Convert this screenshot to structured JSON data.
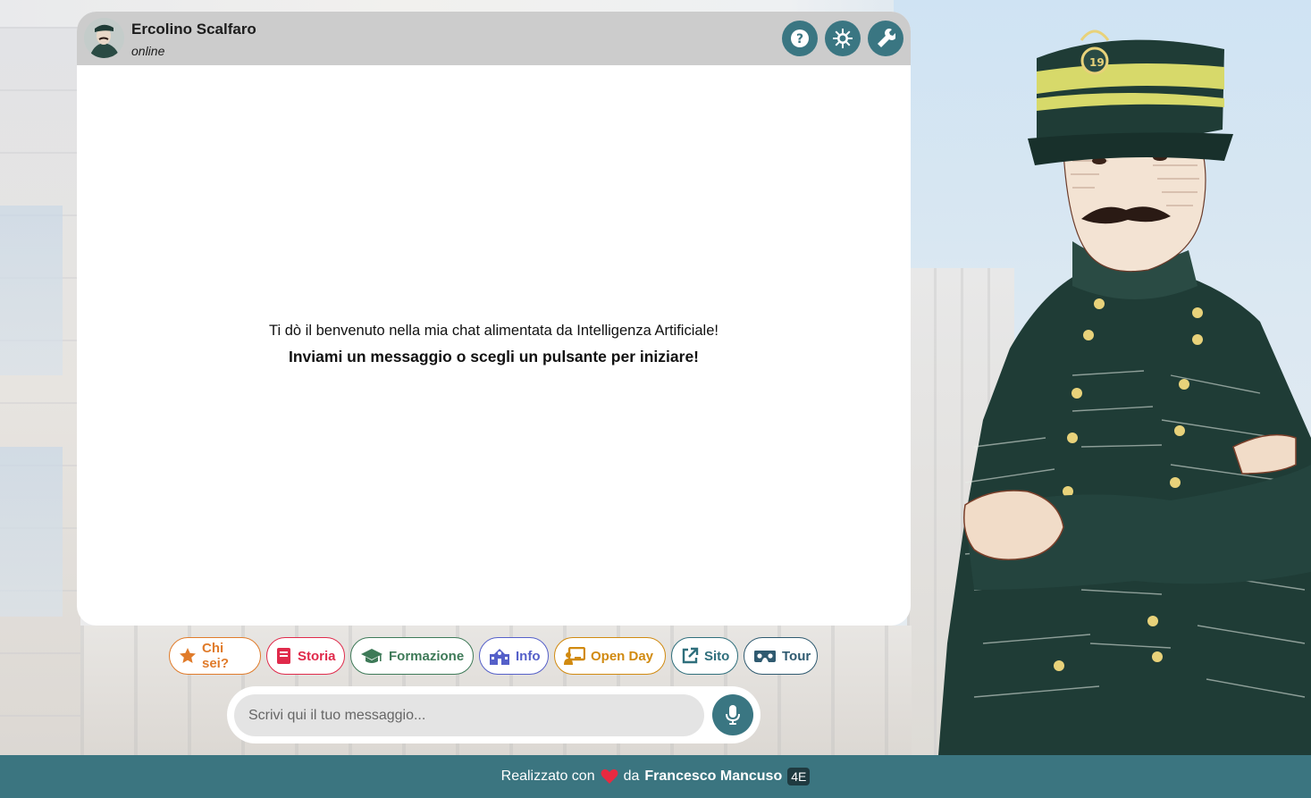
{
  "header": {
    "name": "Ercolino Scalfaro",
    "status": "online"
  },
  "header_buttons": [
    {
      "icon": "question-icon"
    },
    {
      "icon": "gear-icon"
    },
    {
      "icon": "wrench-icon"
    }
  ],
  "welcome": {
    "line1": "Ti dò il benvenuto nella mia chat alimentata da Intelligenza Artificiale!",
    "line2": "Inviami un messaggio o scegli un pulsante per iniziare!"
  },
  "quick_buttons": [
    {
      "label": "Chi sei?",
      "icon": "star-icon",
      "color": "#e07b2a"
    },
    {
      "label": "Storia",
      "icon": "book-icon",
      "color": "#e02a4b"
    },
    {
      "label": "Formazione",
      "icon": "graduation-cap-icon",
      "color": "#3e7a58"
    },
    {
      "label": "Info",
      "icon": "school-icon",
      "color": "#5560c9"
    },
    {
      "label": "Open Day",
      "icon": "presentation-icon",
      "color": "#d18a10"
    },
    {
      "label": "Sito",
      "icon": "external-link-icon",
      "color": "#2f6f7c"
    },
    {
      "label": "Tour",
      "icon": "vr-headset-icon",
      "color": "#2f5a70"
    }
  ],
  "input": {
    "placeholder": "Scrivi qui il tuo messaggio..."
  },
  "footer": {
    "made_with": "Realizzato con",
    "by": "da",
    "author": "Francesco Mancuso",
    "class": "4E"
  },
  "colors": {
    "accent": "#3a7682",
    "header_bg": "#cccccc",
    "footer_bg": "#3b7580"
  }
}
